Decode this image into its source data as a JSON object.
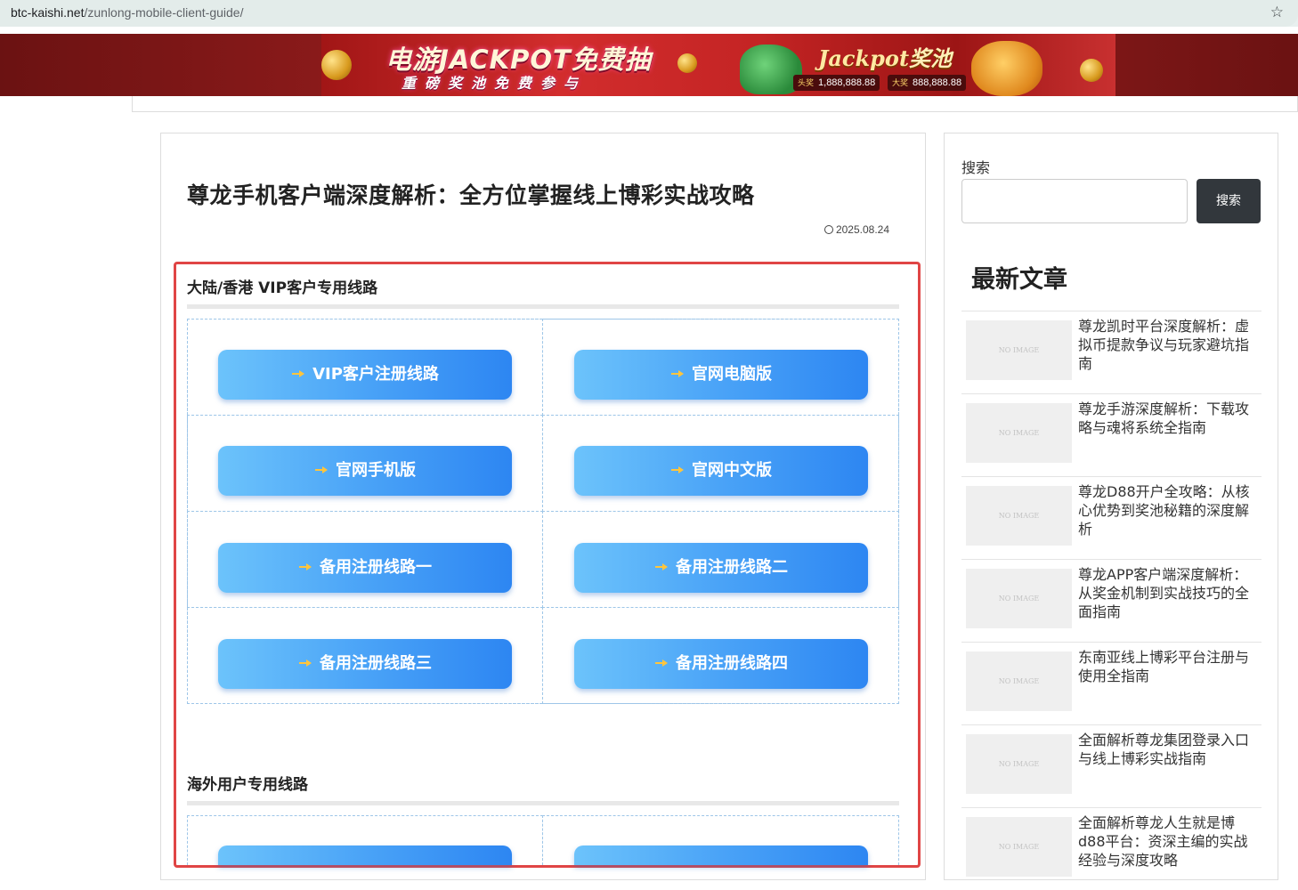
{
  "browser": {
    "url_host": "btc-kaishi.net",
    "url_path": "/zunlong-mobile-client-guide/",
    "bookmark_icon": "star-icon"
  },
  "banner": {
    "title": "电游JACKPOT免费抽",
    "subtitle": "重磅奖池免费参与",
    "jackpot_label": "Jackpot",
    "jackpot_cn": "奖池",
    "pool1_tag": "头奖",
    "pool1_value": "1,888,888.88",
    "pool2_tag": "大奖",
    "pool2_value": "888,888.88"
  },
  "article": {
    "title": "尊龙手机客户端深度解析：全方位掌握线上博彩实战攻略",
    "date": "2025.08.24",
    "section1": {
      "title": "大陆/香港 VIP客户专用线路",
      "buttons": [
        "VIP客户注册线路",
        "官网电脑版",
        "官网手机版",
        "官网中文版",
        "备用注册线路一",
        "备用注册线路二",
        "备用注册线路三",
        "备用注册线路四"
      ]
    },
    "section2": {
      "title": "海外用户专用线路"
    }
  },
  "sidebar": {
    "search_label": "搜索",
    "search_placeholder": "",
    "search_button": "搜索",
    "recent_heading": "最新文章",
    "no_image_text": "NO IMAGE",
    "posts": [
      "尊龙凯时平台深度解析：虚拟币提款争议与玩家避坑指南",
      "尊龙手游深度解析：下载攻略与魂将系统全指南",
      "尊龙D88开户全攻略：从核心优势到奖池秘籍的深度解析",
      "尊龙APP客户端深度解析：从奖金机制到实战技巧的全面指南",
      "东南亚线上博彩平台注册与使用全指南",
      "全面解析尊龙集团登录入口与线上博彩实战指南",
      "全面解析尊龙人生就是博d88平台：资深主编的实战经验与深度攻略"
    ]
  }
}
